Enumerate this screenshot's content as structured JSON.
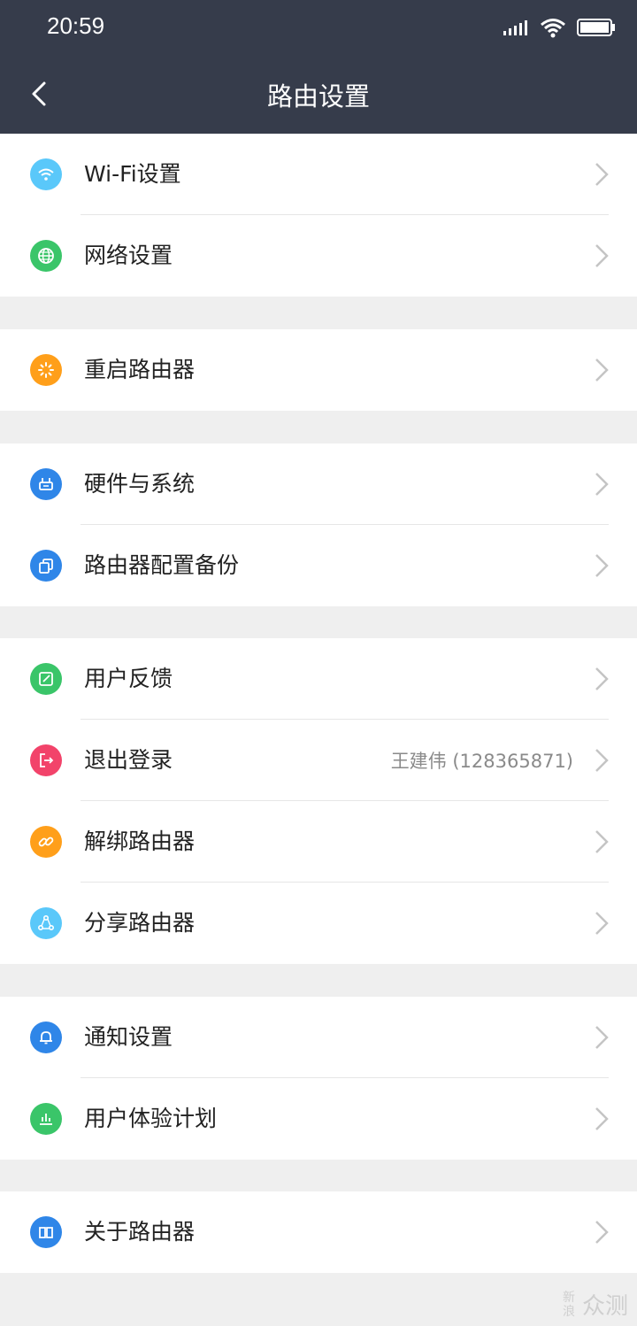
{
  "status_bar": {
    "time": "20:59"
  },
  "header": {
    "title": "路由设置"
  },
  "colors": {
    "header_bg": "#363c4b",
    "blue_light": "#5ac8fa",
    "green": "#3ac569",
    "orange": "#ff9f1a",
    "blue": "#2f86e8",
    "red": "#f2436a",
    "chevron": "#c4c4c4"
  },
  "groups": [
    {
      "items": [
        {
          "label": "Wi-Fi设置",
          "icon": "wifi-icon"
        },
        {
          "label": "网络设置",
          "icon": "globe-icon"
        }
      ]
    },
    {
      "items": [
        {
          "label": "重启路由器",
          "icon": "restart-icon"
        }
      ]
    },
    {
      "items": [
        {
          "label": "硬件与系统",
          "icon": "hardware-icon"
        },
        {
          "label": "路由器配置备份",
          "icon": "backup-icon"
        }
      ]
    },
    {
      "items": [
        {
          "label": "用户反馈",
          "icon": "feedback-icon"
        },
        {
          "label": "退出登录",
          "icon": "logout-icon",
          "value": "王建伟 (128365871)"
        },
        {
          "label": "解绑路由器",
          "icon": "unlink-icon"
        },
        {
          "label": "分享路由器",
          "icon": "share-icon"
        }
      ]
    },
    {
      "items": [
        {
          "label": "通知设置",
          "icon": "bell-icon"
        },
        {
          "label": "用户体验计划",
          "icon": "chart-icon"
        }
      ]
    },
    {
      "items": [
        {
          "label": "关于路由器",
          "icon": "book-icon"
        }
      ]
    }
  ],
  "watermark": {
    "small": "新浪",
    "text": "众测"
  }
}
